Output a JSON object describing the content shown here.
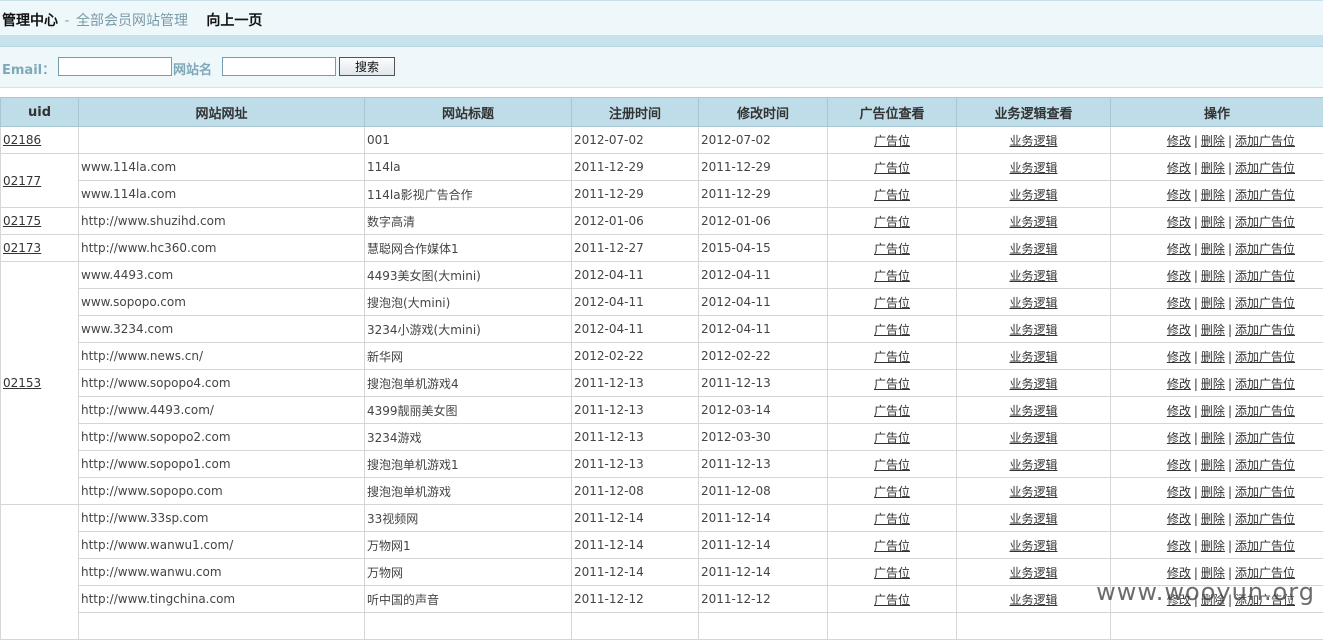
{
  "header": {
    "title": "管理中心",
    "separator": "-",
    "subtitle": "全部会员网站管理",
    "back_link": "向上一页"
  },
  "search": {
    "email_label": "Email：",
    "email_value": "",
    "site_label": "网站名",
    "site_value": "",
    "button_label": "搜索"
  },
  "table": {
    "headers": [
      "uid",
      "网站网址",
      "网站标题",
      "注册时间",
      "修改时间",
      "广告位查看",
      "业务逻辑查看",
      "操作"
    ],
    "action_ads": "广告位",
    "action_logic": "业务逻辑",
    "op_edit": "修改",
    "op_delete": "删除",
    "op_add": "添加广告位",
    "groups": [
      {
        "uid": "02186",
        "rows": [
          {
            "url": "",
            "title": "001",
            "reg": "2012-07-02",
            "mod": "2012-07-02"
          }
        ]
      },
      {
        "uid": "02177",
        "rows": [
          {
            "url": "www.114la.com",
            "title": "114la",
            "reg": "2011-12-29",
            "mod": "2011-12-29"
          },
          {
            "url": "www.114la.com",
            "title": "114la影视广告合作",
            "reg": "2011-12-29",
            "mod": "2011-12-29"
          }
        ]
      },
      {
        "uid": "02175",
        "rows": [
          {
            "url": "http://www.shuzihd.com",
            "title": "数字高清",
            "reg": "2012-01-06",
            "mod": "2012-01-06"
          }
        ]
      },
      {
        "uid": "02173",
        "rows": [
          {
            "url": "http://www.hc360.com",
            "title": "慧聪网合作媒体1",
            "reg": "2011-12-27",
            "mod": "2015-04-15"
          }
        ]
      },
      {
        "uid": "02153",
        "rows": [
          {
            "url": "www.4493.com",
            "title": "4493美女图(大mini)",
            "reg": "2012-04-11",
            "mod": "2012-04-11"
          },
          {
            "url": "www.sopopo.com",
            "title": "搜泡泡(大mini)",
            "reg": "2012-04-11",
            "mod": "2012-04-11"
          },
          {
            "url": "www.3234.com",
            "title": "3234小游戏(大mini)",
            "reg": "2012-04-11",
            "mod": "2012-04-11"
          },
          {
            "url": "http://www.news.cn/",
            "title": "新华网",
            "reg": "2012-02-22",
            "mod": "2012-02-22"
          },
          {
            "url": "http://www.sopopo4.com",
            "title": "搜泡泡单机游戏4",
            "reg": "2011-12-13",
            "mod": "2011-12-13"
          },
          {
            "url": "http://www.4493.com/",
            "title": "4399靓丽美女图",
            "reg": "2011-12-13",
            "mod": "2012-03-14"
          },
          {
            "url": "http://www.sopopo2.com",
            "title": "3234游戏",
            "reg": "2011-12-13",
            "mod": "2012-03-30"
          },
          {
            "url": "http://www.sopopo1.com",
            "title": "搜泡泡单机游戏1",
            "reg": "2011-12-13",
            "mod": "2011-12-13"
          },
          {
            "url": "http://www.sopopo.com",
            "title": "搜泡泡单机游戏",
            "reg": "2011-12-08",
            "mod": "2011-12-08"
          }
        ]
      },
      {
        "uid": "",
        "rows": [
          {
            "url": "http://www.33sp.com",
            "title": "33视频网",
            "reg": "2011-12-14",
            "mod": "2011-12-14"
          },
          {
            "url": "http://www.wanwu1.com/",
            "title": "万物网1",
            "reg": "2011-12-14",
            "mod": "2011-12-14"
          },
          {
            "url": "http://www.wanwu.com",
            "title": "万物网",
            "reg": "2011-12-14",
            "mod": "2011-12-14"
          },
          {
            "url": "http://www.tingchina.com",
            "title": "听中国的声音",
            "reg": "2011-12-12",
            "mod": "2011-12-12"
          },
          {
            "url": "",
            "title": "",
            "reg": "",
            "mod": ""
          }
        ]
      }
    ]
  },
  "watermark": "www.wooyun.org"
}
